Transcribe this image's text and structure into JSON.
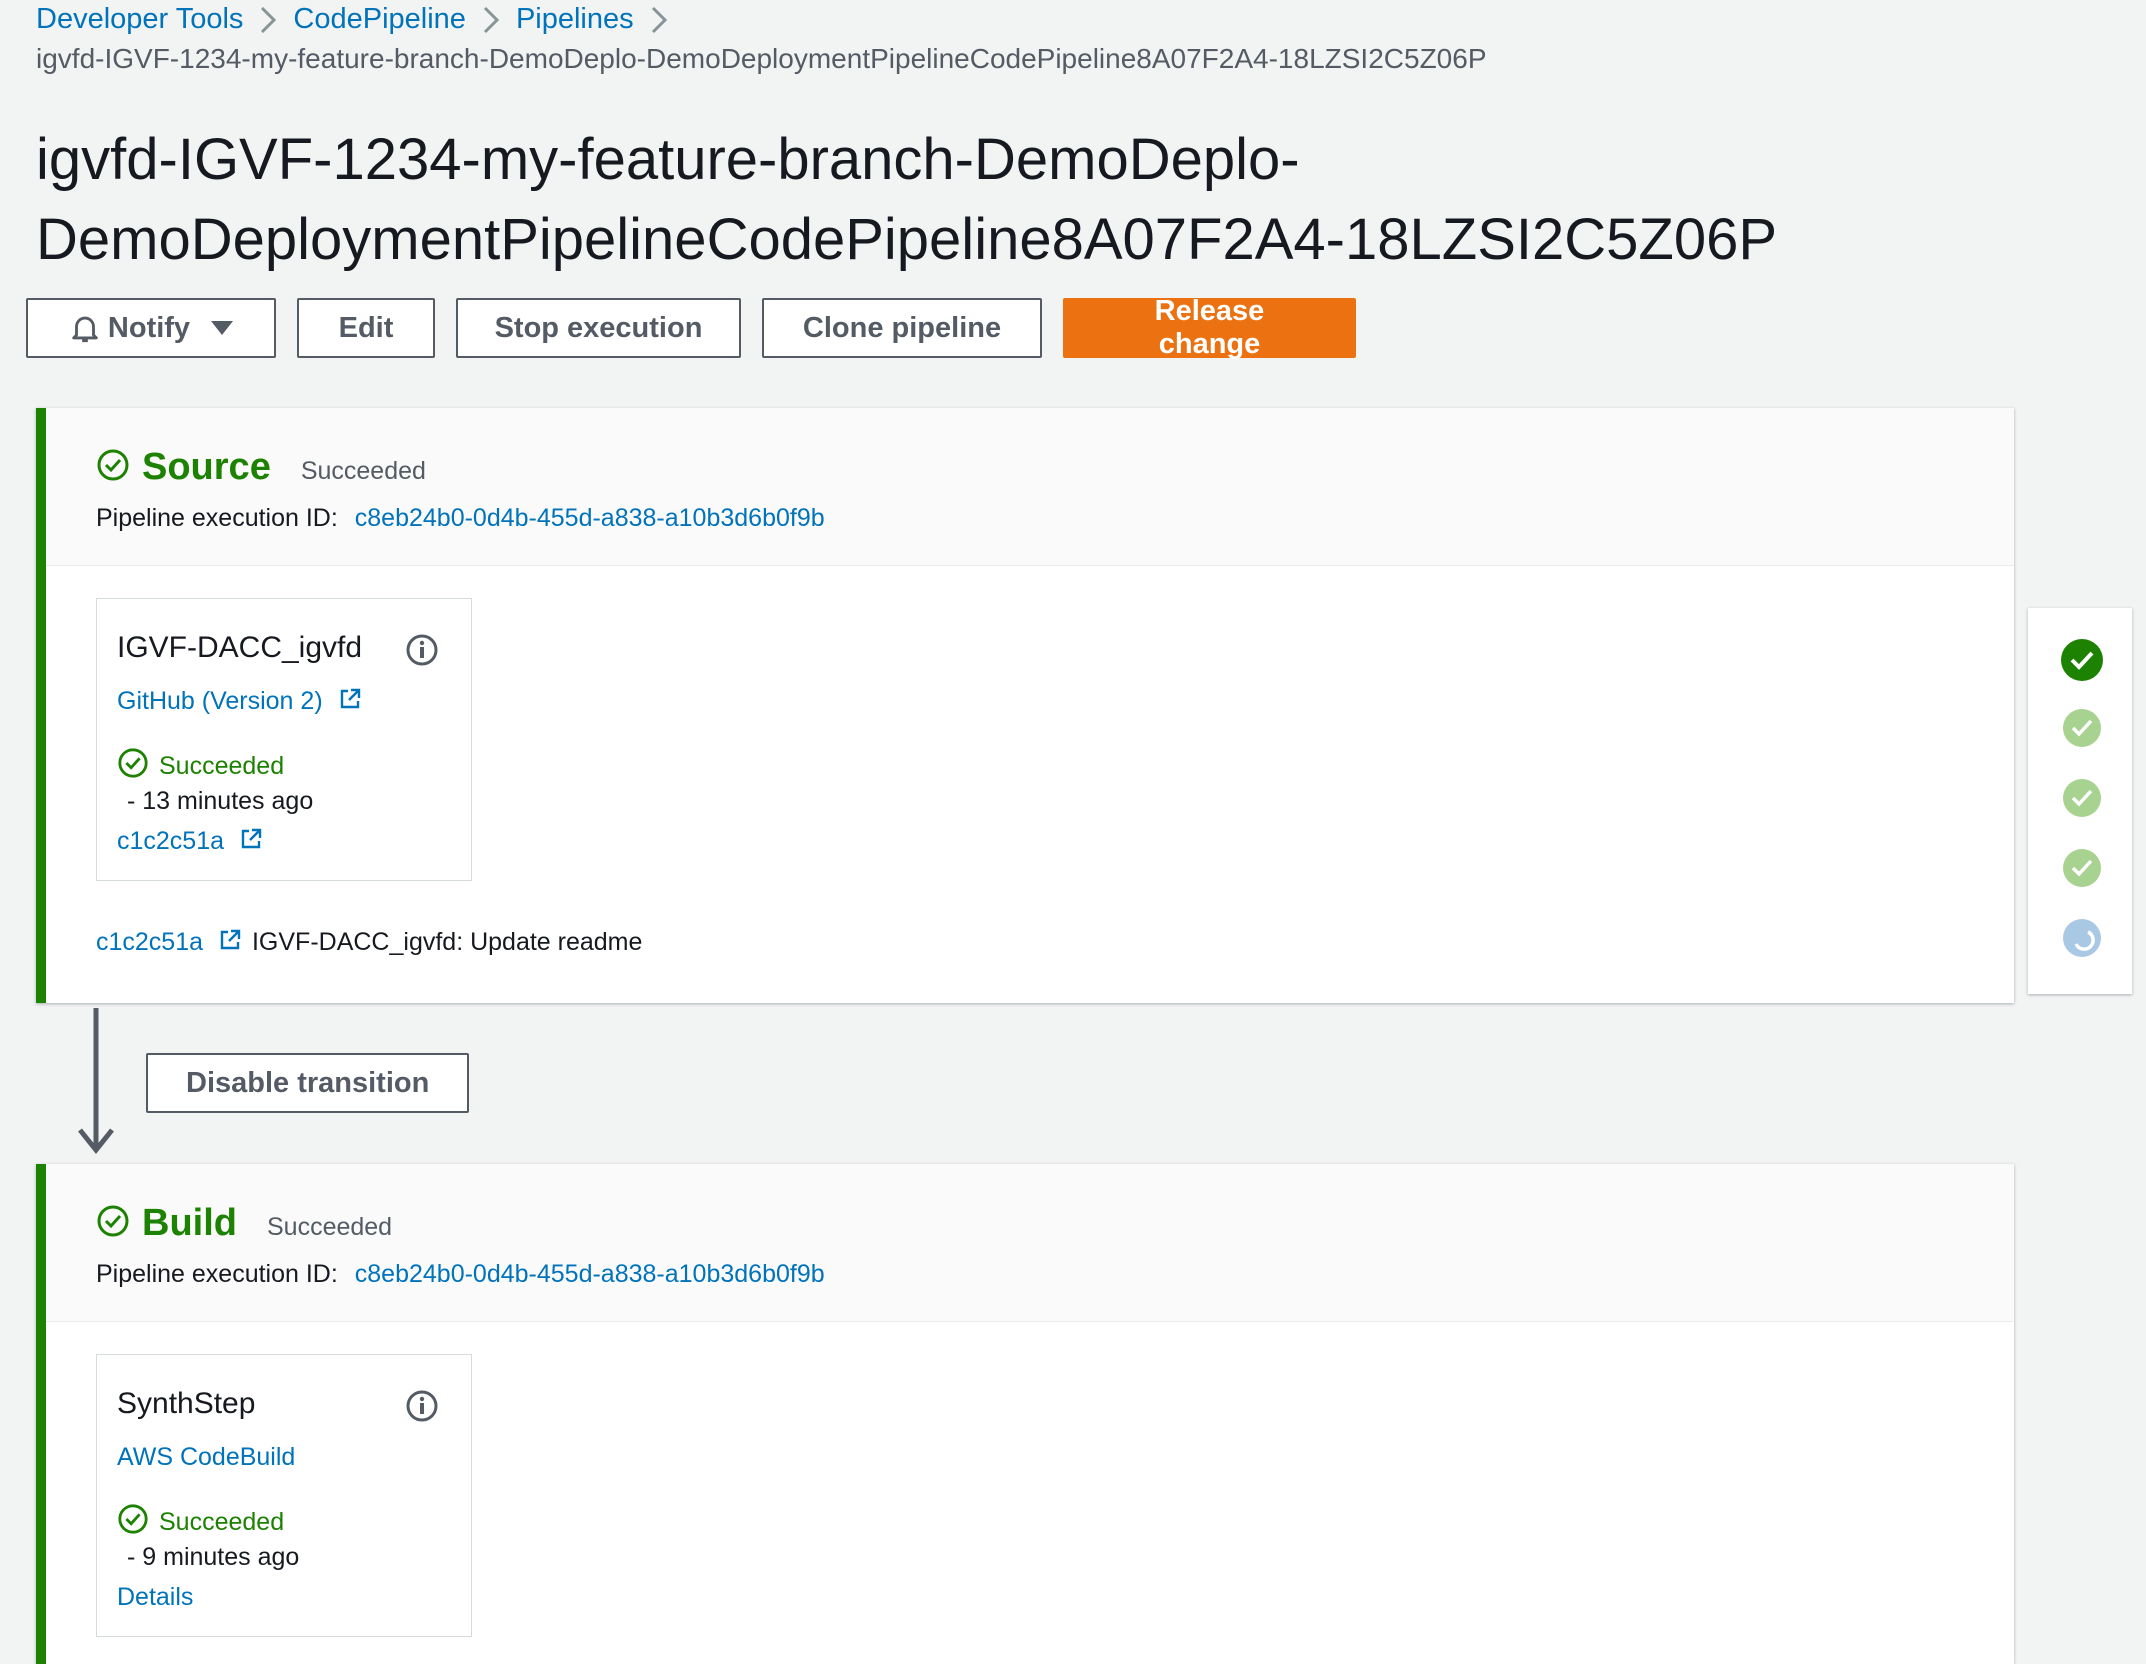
{
  "breadcrumb": {
    "items": [
      "Developer Tools",
      "CodePipeline",
      "Pipelines"
    ],
    "current": "igvfd-IGVF-1234-my-feature-branch-DemoDeplo-DemoDeploymentPipelineCodePipeline8A07F2A4-18LZSI2C5Z06P"
  },
  "page": {
    "title_line1": "igvfd-IGVF-1234-my-feature-branch-DemoDeplo-",
    "title_line2": "DemoDeploymentPipelineCodePipeline8A07F2A4-18LZSI2C5Z06P"
  },
  "toolbar": {
    "notify_label": "Notify",
    "edit_label": "Edit",
    "stop_label": "Stop execution",
    "clone_label": "Clone pipeline",
    "release_label": "Release change"
  },
  "stages": [
    {
      "name": "Source",
      "status": "Succeeded",
      "exec_label": "Pipeline execution ID:",
      "exec_id": "c8eb24b0-0d4b-455d-a838-a10b3d6b0f9b",
      "action": {
        "name": "IGVF-DACC_igvfd",
        "provider": "GitHub (Version 2)",
        "status": "Succeeded",
        "time": "-  13 minutes ago",
        "link": "c1c2c51a"
      },
      "commit": {
        "id": "c1c2c51a",
        "message": "IGVF-DACC_igvfd: Update readme"
      }
    },
    {
      "name": "Build",
      "status": "Succeeded",
      "exec_label": "Pipeline execution ID:",
      "exec_id": "c8eb24b0-0d4b-455d-a838-a10b3d6b0f9b",
      "action": {
        "name": "SynthStep",
        "provider": "AWS CodeBuild",
        "status": "Succeeded",
        "time": "-  9 minutes ago",
        "link": "Details"
      }
    }
  ],
  "transition": {
    "button_label": "Disable transition"
  },
  "progress": {
    "steps": [
      "succeeded-current",
      "succeeded",
      "succeeded",
      "succeeded",
      "in-progress"
    ]
  },
  "colors": {
    "success": "#1d8102",
    "link": "#0073bb",
    "primary": "#ec7211",
    "light_success": "#a7d28f",
    "in_progress": "#a8c8e4"
  },
  "icons": [
    "chevron-right-icon",
    "bell-icon",
    "caret-down-icon",
    "check-circle-icon",
    "info-icon",
    "external-link-icon",
    "arrow-down-icon",
    "spinner-icon"
  ]
}
